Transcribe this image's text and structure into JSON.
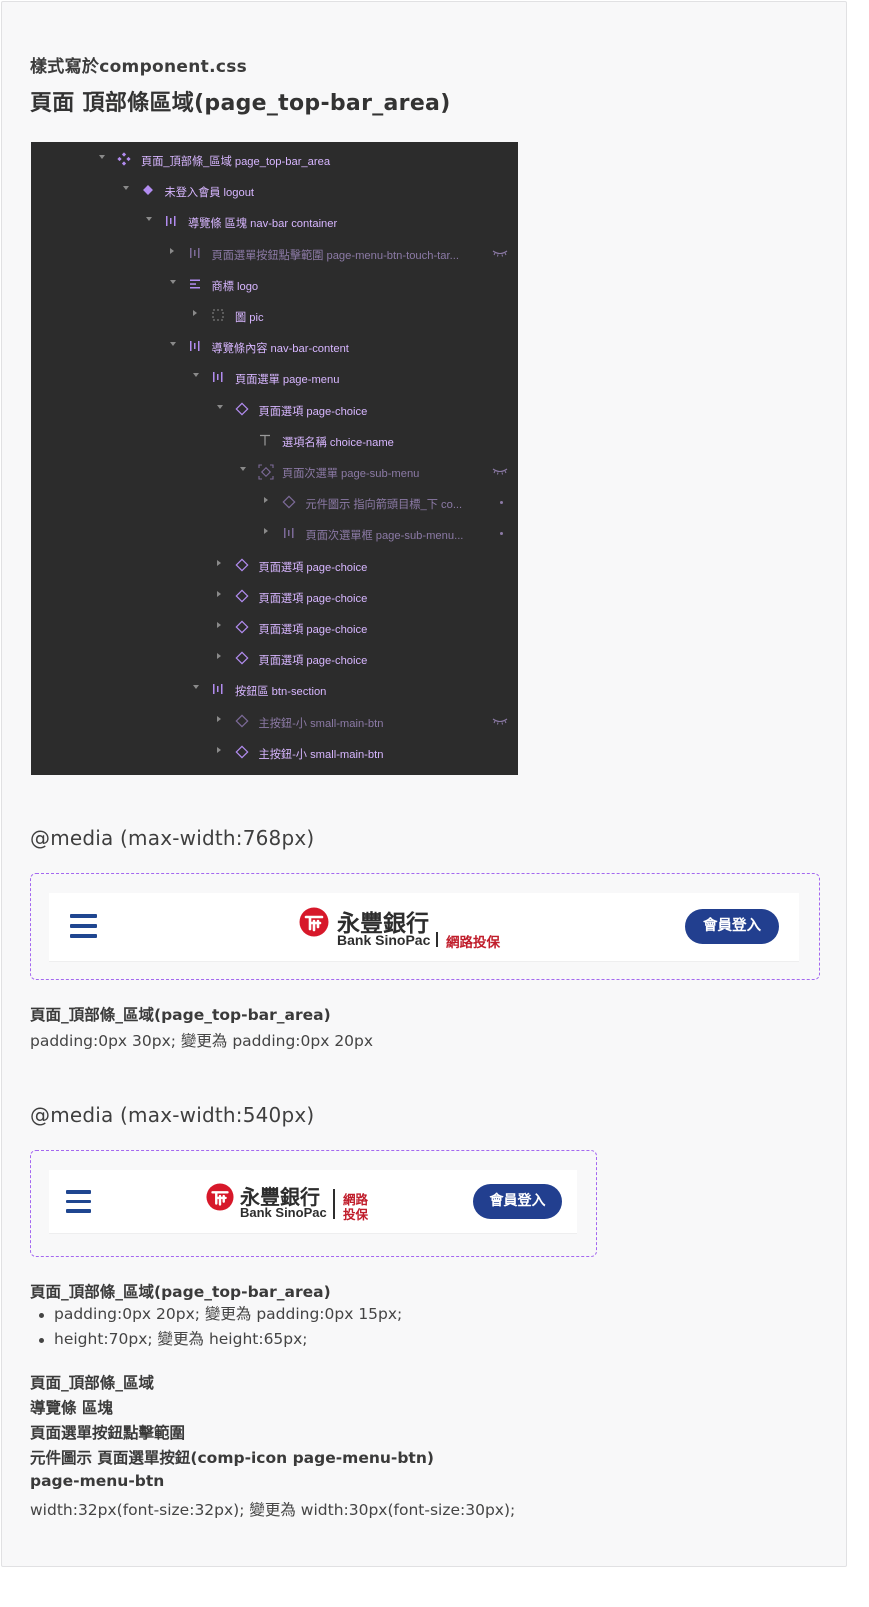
{
  "header": {
    "subtitle": "樣式寫於component.css",
    "title": "頁面 頂部條區域(page_top-bar_area)"
  },
  "layers": [
    {
      "label": "頁面_頂部條_區域 page_top-bar_area",
      "icon": "component-icon",
      "chevron": "down",
      "dim": false
    },
    {
      "label": "未登入會員 logout",
      "icon": "instance-diamond-icon",
      "chevron": "down",
      "dim": false
    },
    {
      "label": "導覽條 區塊 nav-bar container",
      "icon": "horizontal-autolayout-icon",
      "chevron": "down",
      "dim": false
    },
    {
      "label": "頁面選單按鈕點擊範圍 page-menu-btn-touch-tar...",
      "icon": "horizontal-autolayout-icon",
      "chevron": "right",
      "dim": true,
      "hidden": true
    },
    {
      "label": "商標 logo",
      "icon": "vertical-autolayout-icon",
      "chevron": "down",
      "dim": false
    },
    {
      "label": "圖 pic",
      "icon": "frame-dashed-icon",
      "chevron": "right",
      "dim": false
    },
    {
      "label": "導覽條內容 nav-bar-content",
      "icon": "horizontal-autolayout-icon",
      "chevron": "down",
      "dim": false
    },
    {
      "label": "頁面選單 page-menu",
      "icon": "horizontal-autolayout-icon",
      "chevron": "down",
      "dim": false
    },
    {
      "label": "頁面選項 page-choice",
      "icon": "instance-outline-icon",
      "chevron": "down",
      "dim": false
    },
    {
      "label": "選項名稱 choice-name",
      "icon": "text-icon",
      "chevron": "",
      "dim": false
    },
    {
      "label": "頁面次選單 page-sub-menu",
      "icon": "frame-selection-icon",
      "chevron": "down",
      "dim": true,
      "hidden": true
    },
    {
      "label": "元件圖示 指向箭頭目標_下 co...",
      "icon": "instance-outline-icon",
      "chevron": "right",
      "dim": true,
      "dot": true
    },
    {
      "label": "頁面次選單框 page-sub-menu...",
      "icon": "horizontal-autolayout-icon",
      "chevron": "right",
      "dim": true,
      "dot": true
    },
    {
      "label": "頁面選項 page-choice",
      "icon": "instance-outline-icon",
      "chevron": "right",
      "dim": false
    },
    {
      "label": "頁面選項 page-choice",
      "icon": "instance-outline-icon",
      "chevron": "right",
      "dim": false
    },
    {
      "label": "頁面選項 page-choice",
      "icon": "instance-outline-icon",
      "chevron": "right",
      "dim": false
    },
    {
      "label": "頁面選項 page-choice",
      "icon": "instance-outline-icon",
      "chevron": "right",
      "dim": false
    },
    {
      "label": "按鈕區 btn-section",
      "icon": "horizontal-autolayout-icon",
      "chevron": "down",
      "dim": false
    },
    {
      "label": "主按鈕-小 small-main-btn",
      "icon": "instance-outline-icon",
      "chevron": "right",
      "dim": true,
      "hidden": true
    },
    {
      "label": "主按鈕-小 small-main-btn",
      "icon": "instance-outline-icon",
      "chevron": "right",
      "dim": false
    }
  ],
  "media768": {
    "heading": "@media (max-width:768px)",
    "brand_cn": "永豐銀行",
    "brand_en": "Bank SinoPac",
    "brand_sub": "網路投保",
    "login_label": "會員登入",
    "note_title": "頁面_頂部條_區域(page_top-bar_area)",
    "note_text": "padding:0px 30px; 變更為 padding:0px 20px"
  },
  "media540": {
    "heading": "@media (max-width:540px)",
    "brand_cn": "永豐銀行",
    "brand_en": "Bank SinoPac",
    "brand_sub_1": "網路",
    "brand_sub_2": "投保",
    "login_label": "會員登入",
    "note_title": "頁面_頂部條_區域(page_top-bar_area)",
    "bullets": [
      "padding:0px 20px; 變更為 padding:0px 15px;",
      "height:70px; 變更為 height:65px;"
    ],
    "path_lines": [
      "頁面_頂部條_區域",
      "導覽條 區塊",
      "頁面選單按鈕點擊範圍",
      "元件圖示 頁面選單按鈕(comp-icon page-menu-btn)",
      "page-menu-btn"
    ],
    "final_text": "width:32px(font-size:32px); 變更為 width:30px(font-size:30px);"
  },
  "colors": {
    "panel_bg": "#2c2c2c",
    "layer_text": "#d7b6ff",
    "dashed_frame": "#a468f0",
    "brand_blue": "#223f8f",
    "brand_red": "#c01d2b"
  }
}
